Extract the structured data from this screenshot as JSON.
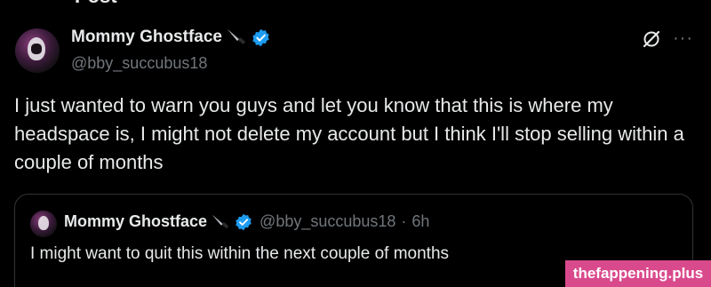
{
  "header": {
    "title": "Post"
  },
  "post": {
    "author": {
      "display_name": "Mommy Ghostface",
      "handle": "@bby_succubus18",
      "emoji_icon": "knife-icon",
      "verified_icon": "verified-badge-icon"
    },
    "actions": {
      "grok_icon": "grok-icon",
      "more_label": "···"
    },
    "text": "I just wanted to warn you guys and let you know that this is where my headspace is, I might not delete my account but I think I'll stop selling within a couple of months"
  },
  "quote": {
    "author": {
      "display_name": "Mommy Ghostface",
      "handle": "@bby_succubus18",
      "separator": "·",
      "time": "6h"
    },
    "text": "I might want to quit this within the next couple of months"
  },
  "watermark": {
    "text": "thefappening.plus"
  },
  "colors": {
    "background": "#000000",
    "text": "#e7e9ea",
    "muted": "#71767b",
    "verified": "#1d9bf0",
    "border": "#2f3336",
    "watermark_bg": "#d94a8c"
  }
}
